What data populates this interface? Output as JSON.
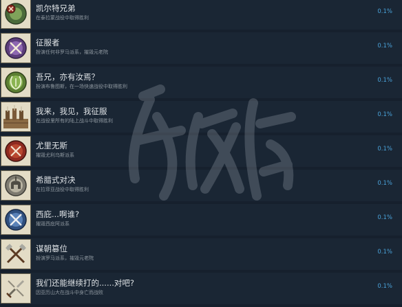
{
  "achievements": [
    {
      "title": "凯尔特兄弟",
      "desc": "在泰拉蒙战役中取得胜利",
      "percent": "0.1%",
      "icon": "celtic-brothers-icon"
    },
    {
      "title": "征服者",
      "desc": "扮演任何非罗马派系，摧毁元老院",
      "percent": "0.1%",
      "icon": "conqueror-icon"
    },
    {
      "title": "吾兄，亦有汝焉？",
      "desc": "扮演布鲁图斯，在一场快速战役中取得胜利",
      "percent": "0.1%",
      "icon": "laurel-wreath-icon"
    },
    {
      "title": "我来，我见，我征服",
      "desc": "在战役里所有的陆上战斗中取得胜利",
      "percent": "0.1%",
      "icon": "legion-battle-icon"
    },
    {
      "title": "尤里无斯",
      "desc": "摧毁尤利乌斯派系",
      "percent": "0.1%",
      "icon": "julii-shield-icon"
    },
    {
      "title": "希腊式对决",
      "desc": "在拉菲亚战役中取得胜利",
      "percent": "0.1%",
      "icon": "greek-helmet-icon"
    },
    {
      "title": "西庇...啊谁?",
      "desc": "摧毁西庇阿派系",
      "percent": "0.1%",
      "icon": "crossed-swords-icon"
    },
    {
      "title": "谋朝篡位",
      "desc": "扮演罗马派系，摧毁元老院",
      "percent": "0.1%",
      "icon": "crossed-axes-icon"
    },
    {
      "title": "我们还能继续打的......对吧?",
      "desc": "因亚历山大在战斗中身亡而战败",
      "percent": "0.1%",
      "icon": "broken-sword-icon"
    }
  ]
}
